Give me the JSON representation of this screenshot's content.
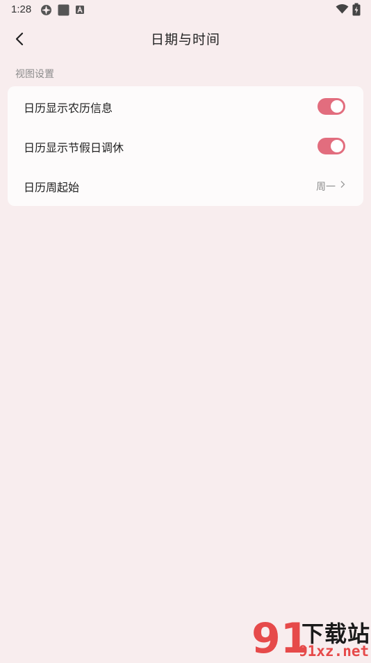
{
  "status_bar": {
    "time": "1:28",
    "icons": [
      "vpn-icon",
      "square-app-icon",
      "font-app-icon",
      "wifi-icon",
      "battery-charging-icon"
    ]
  },
  "header": {
    "back_icon": "chevron-left-icon",
    "title": "日期与时间"
  },
  "section": {
    "title": "视图设置"
  },
  "settings": {
    "lunar": {
      "label": "日历显示农历信息",
      "enabled": true
    },
    "holiday": {
      "label": "日历显示节假日调休",
      "enabled": true
    },
    "week_start": {
      "label": "日历周起始",
      "value": "周一"
    }
  },
  "colors": {
    "background": "#f8edee",
    "card": "#fdfbfb",
    "accent": "#e26d7e"
  },
  "watermark": {
    "brand_numeral": "91",
    "brand_text": "下载站",
    "url": "91xz.net"
  }
}
